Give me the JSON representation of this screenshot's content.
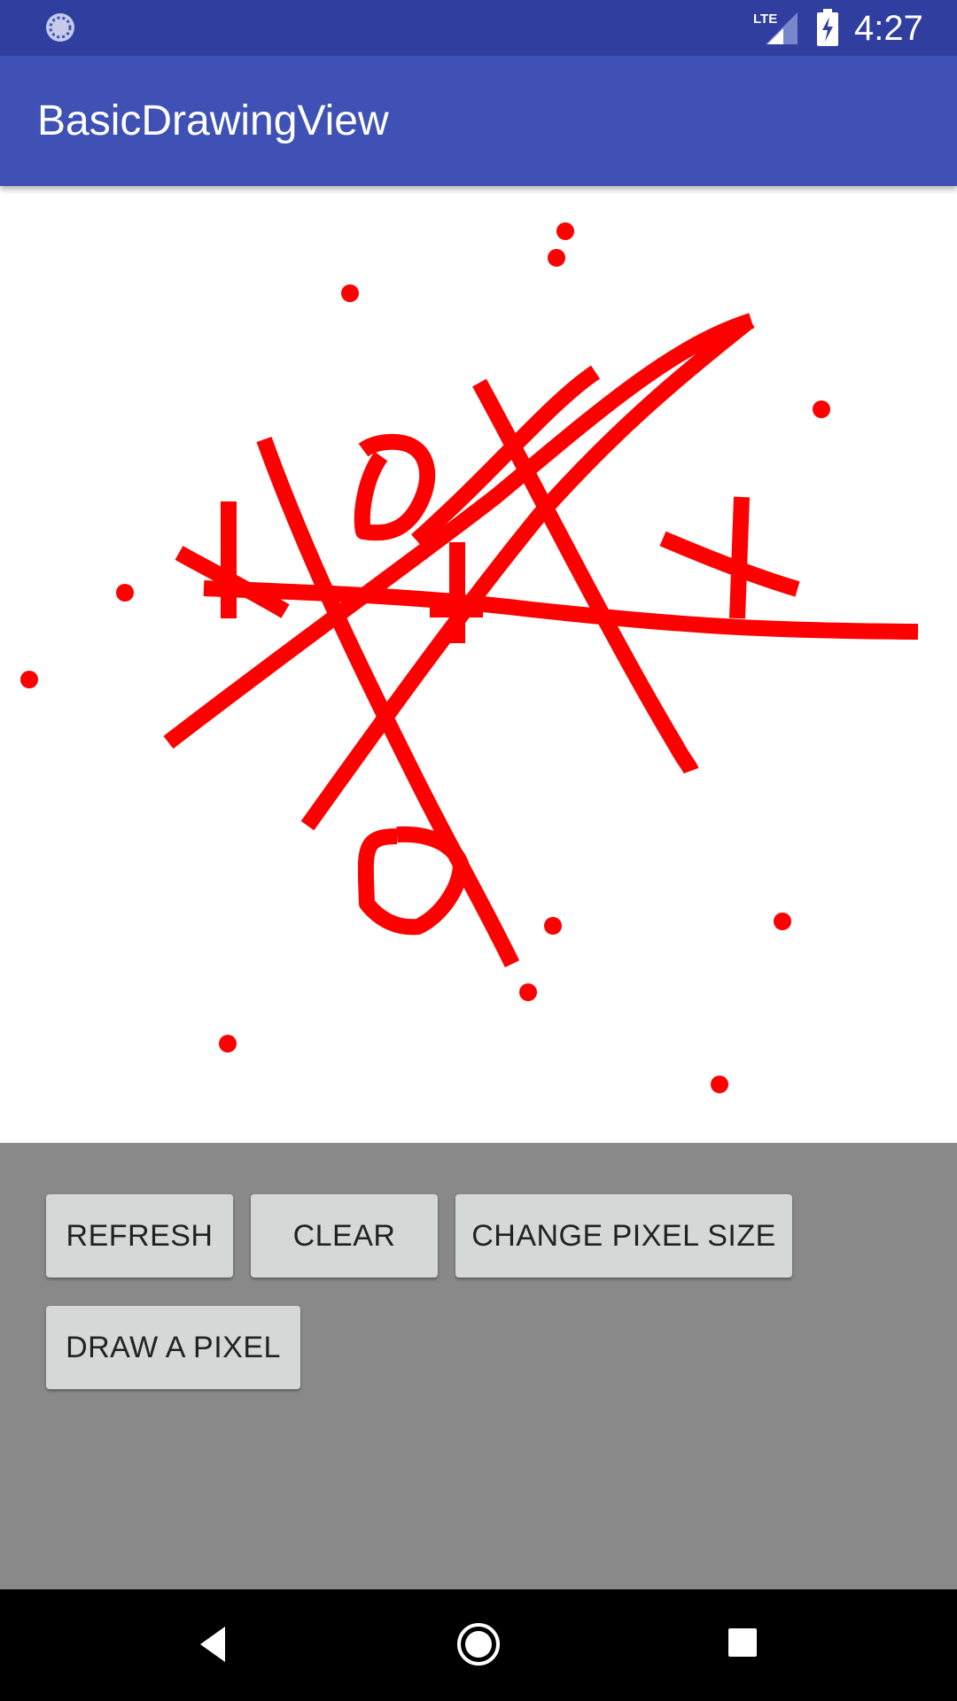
{
  "status_bar": {
    "time": "4:27",
    "network": "LTE",
    "icons": [
      "sync-icon",
      "lte-signal-icon",
      "battery-charging-icon"
    ]
  },
  "app_bar": {
    "title": "BasicDrawingView"
  },
  "canvas": {
    "stroke_color": "#ff0000",
    "content": "red freehand strokes and scattered dots"
  },
  "buttons": {
    "refresh": "REFRESH",
    "clear": "CLEAR",
    "change_pixel_size": "CHANGE PIXEL SIZE",
    "draw_a_pixel": "DRAW A PIXEL"
  },
  "nav_bar": {
    "icons": [
      "back-icon",
      "home-icon",
      "recents-icon"
    ]
  },
  "colors": {
    "status_bar": "#303f9f",
    "app_bar": "#3f51b5",
    "controls_background": "#898989",
    "button_background": "#d6d7d7",
    "drawing": "#ff0000"
  }
}
